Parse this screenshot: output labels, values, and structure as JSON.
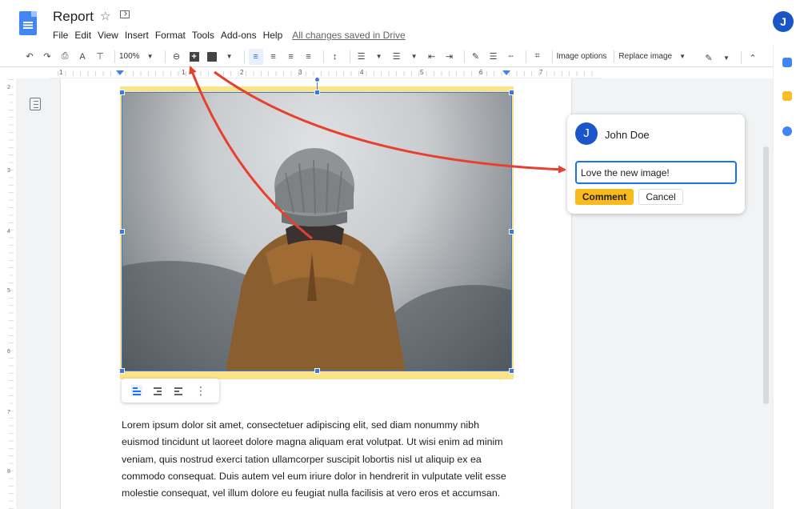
{
  "header": {
    "title": "Report",
    "menu": [
      "File",
      "Edit",
      "View",
      "Insert",
      "Format",
      "Tools",
      "Add-ons",
      "Help"
    ],
    "save_status": "All changes saved in Drive",
    "avatar_initial": "J"
  },
  "toolbar": {
    "zoom": "100%",
    "image_options": "Image options",
    "replace_image": "Replace image"
  },
  "ruler": {
    "numbers": [
      "1",
      "1",
      "2",
      "3",
      "4",
      "5",
      "6",
      "7"
    ],
    "vertical_numbers": [
      "2",
      "3",
      "4",
      "5",
      "6",
      "7",
      "8"
    ]
  },
  "comment": {
    "avatar_initial": "J",
    "author": "John Doe",
    "input_value": "Love the new image!",
    "comment_button": "Comment",
    "cancel_button": "Cancel"
  },
  "body": {
    "lines": [
      "Lorem ipsum dolor sit amet, consectetuer adipiscing elit, sed diam nonummy nibh",
      "euismod tincidunt ut laoreet dolore magna aliquam erat volutpat. Ut wisi enim ad minim",
      "veniam, quis nostrud exerci tation ullamcorper suscipit lobortis nisl ut aliquip ex ea",
      "commodo consequat. Duis autem vel eum iriure dolor in hendrerit in vulputate velit esse",
      "molestie consequat, vel illum dolore eu feugiat nulla facilisis at vero eros et accumsan."
    ]
  },
  "colors": {
    "accent": "#1a73e8",
    "docs_blue": "#4285f4",
    "comment_button": "#f9ba1d",
    "arrow": "#e8402e",
    "image_border": "#fbe38a"
  },
  "icons": {
    "star": "star-icon",
    "move": "folder-move-icon",
    "undo": "undo-icon",
    "redo": "redo-icon",
    "print": "print-icon",
    "spellcheck": "spellcheck-icon",
    "paint_format": "paint-format-icon",
    "link": "link-icon",
    "comment_add": "add-comment-icon",
    "insert_image": "insert-image-icon",
    "crop": "crop-icon",
    "edit_mode": "pencil-icon",
    "collapse": "chevron-up-icon",
    "outline": "document-outline-icon",
    "more": "more-vertical-icon"
  }
}
